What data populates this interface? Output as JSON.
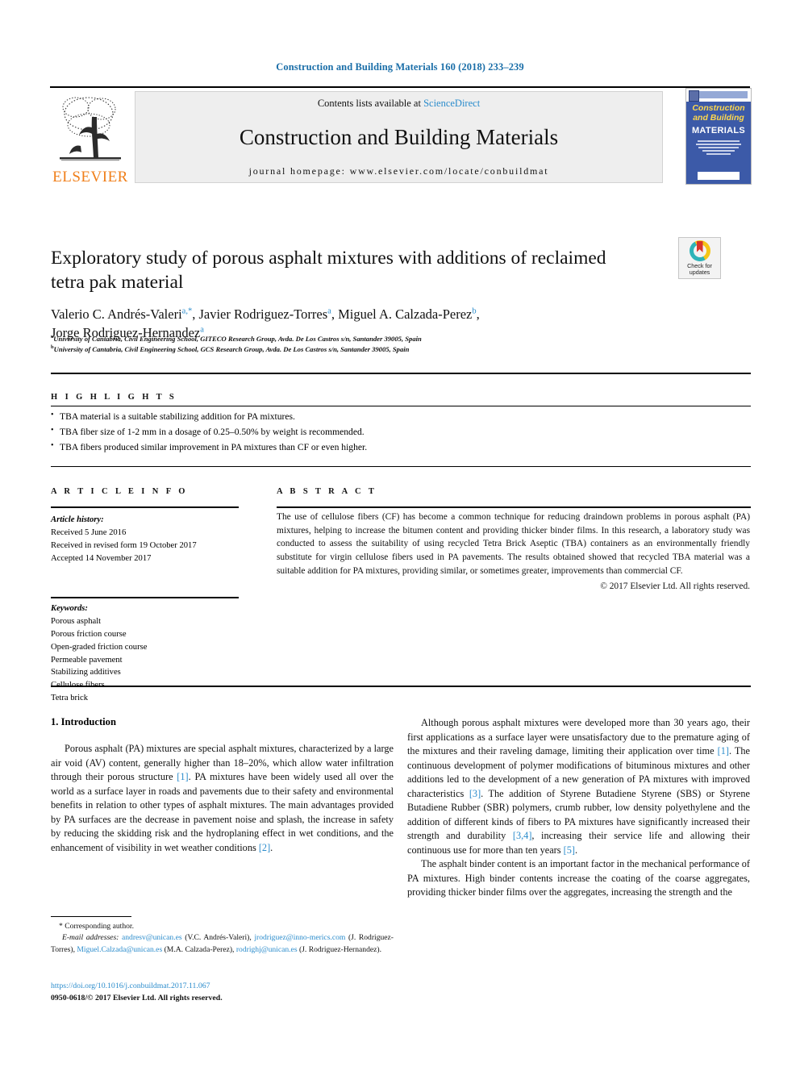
{
  "running_head": "Construction and Building Materials 160 (2018) 233–239",
  "masthead": {
    "contents_prefix": "Contents lists available at ",
    "contents_link": "ScienceDirect",
    "journal_name": "Construction and Building Materials",
    "homepage": "journal homepage: www.elsevier.com/locate/conbuildmat",
    "publisher_logo_text": "ELSEVIER",
    "cover": {
      "line1": "Construction",
      "line2": "and Building",
      "line3": "MATERIALS"
    }
  },
  "crossmark": {
    "line1": "Check for",
    "line2": "updates"
  },
  "article": {
    "title": "Exploratory study of porous asphalt mixtures with additions of reclaimed tetra pak material",
    "authors": [
      {
        "name": "Valerio C. Andrés-Valeri",
        "marks": "a,*"
      },
      {
        "name": "Javier Rodriguez-Torres",
        "marks": "a"
      },
      {
        "name": "Miguel A. Calzada-Perez",
        "marks": "b"
      },
      {
        "name": "Jorge Rodriguez-Hernandez",
        "marks": "a"
      }
    ],
    "affiliations": [
      {
        "mark": "a",
        "text": "University of Cantabria, Civil Engineering School, GITECO Research Group, Avda. De Los Castros s/n, Santander 39005, Spain"
      },
      {
        "mark": "b",
        "text": "University of Cantabria, Civil Engineering School, GCS Research Group, Avda. De Los Castros s/n, Santander 39005, Spain"
      }
    ]
  },
  "highlights": {
    "heading": "H I G H L I G H T S",
    "items": [
      "TBA material is a suitable stabilizing addition for PA mixtures.",
      "TBA fiber size of 1-2 mm in a dosage of 0.25–0.50% by weight is recommended.",
      "TBA fibers produced similar improvement in PA mixtures than CF or even higher."
    ]
  },
  "article_info": {
    "heading": "A R T I C L E   I N F O",
    "history_label": "Article history:",
    "history": [
      "Received 5 June 2016",
      "Received in revised form 19 October 2017",
      "Accepted 14 November 2017"
    ],
    "keywords_label": "Keywords:",
    "keywords": [
      "Porous asphalt",
      "Porous friction course",
      "Open-graded friction course",
      "Permeable pavement",
      "Stabilizing additives",
      "Cellulose fibers",
      "Tetra brick"
    ]
  },
  "abstract": {
    "heading": "A B S T R A C T",
    "text": "The use of cellulose fibers (CF) has become a common technique for reducing draindown problems in porous asphalt (PA) mixtures, helping to increase the bitumen content and providing thicker binder films. In this research, a laboratory study was conducted to assess the suitability of using recycled Tetra Brick Aseptic (TBA) containers as an environmentally friendly substitute for virgin cellulose fibers used in PA pavements. The results obtained showed that recycled TBA material was a suitable addition for PA mixtures, providing similar, or sometimes greater, improvements than commercial CF.",
    "copyright": "© 2017 Elsevier Ltd. All rights reserved."
  },
  "body": {
    "section_heading": "1. Introduction",
    "left_paragraph_1a": "Porous asphalt (PA) mixtures are special asphalt mixtures, characterized by a large air void (AV) content, generally higher than 18–20%, which allow water infiltration through their porous structure ",
    "left_ref_1": "[1]",
    "left_paragraph_1b": ". PA mixtures have been widely used all over the world as a surface layer in roads and pavements due to their safety and environmental benefits in relation to other types of asphalt mixtures. The main advantages provided by PA surfaces are the decrease in pavement noise and splash, the increase in safety by reducing the skidding risk and the hydroplaning effect in wet conditions, and the enhancement of visibility in wet weather conditions ",
    "left_ref_2": "[2]",
    "left_paragraph_1c": ".",
    "right_p1_a": "Although porous asphalt mixtures were developed more than 30 years ago, their first applications as a surface layer were unsatisfactory due to the premature aging of the mixtures and their raveling damage, limiting their application over time ",
    "right_ref_1": "[1]",
    "right_p1_b": ". The continuous development of polymer modifications of bituminous mixtures and other additions led to the development of a new generation of PA mixtures with improved characteristics ",
    "right_ref_3": "[3]",
    "right_p1_c": ". The addition of Styrene Butadiene Styrene (SBS) or Styrene Butadiene Rubber (SBR) polymers, crumb rubber, low density polyethylene and the addition of different kinds of fibers to PA mixtures have significantly increased their strength and durability ",
    "right_ref_34": "[3,4]",
    "right_p1_d": ", increasing their service life and allowing their continuous use for more than ten years ",
    "right_ref_5": "[5]",
    "right_p1_e": ".",
    "right_p2": "The asphalt binder content is an important factor in the mechanical performance of PA mixtures. High binder contents increase the coating of the coarse aggregates, providing thicker binder films over the aggregates, increasing the strength and the"
  },
  "footnotes": {
    "corresponding": "* Corresponding author.",
    "email_label": "E-mail addresses:",
    "emails": [
      {
        "address": "andresv@unican.es",
        "owner": "(V.C. Andrés-Valeri),"
      },
      {
        "address": "jrodriguez@inno-merics.com",
        "owner": "(J. Rodriguez-Torres),"
      },
      {
        "address": "Miguel.Calzada@unican.es",
        "owner": "(M.A. Calzada-Perez),"
      },
      {
        "address": "rodrighj@unican.es",
        "owner": "(J. Rodriguez-Hernandez)."
      }
    ],
    "doi": "https://doi.org/10.1016/j.conbuildmat.2017.11.067",
    "issn_line": "0950-0618/© 2017 Elsevier Ltd. All rights reserved."
  },
  "colors": {
    "link": "#2b8ccc",
    "running_head": "#1a6ea8",
    "elsevier_orange": "#f07f1a",
    "cover_blue": "#3c5aa8"
  }
}
